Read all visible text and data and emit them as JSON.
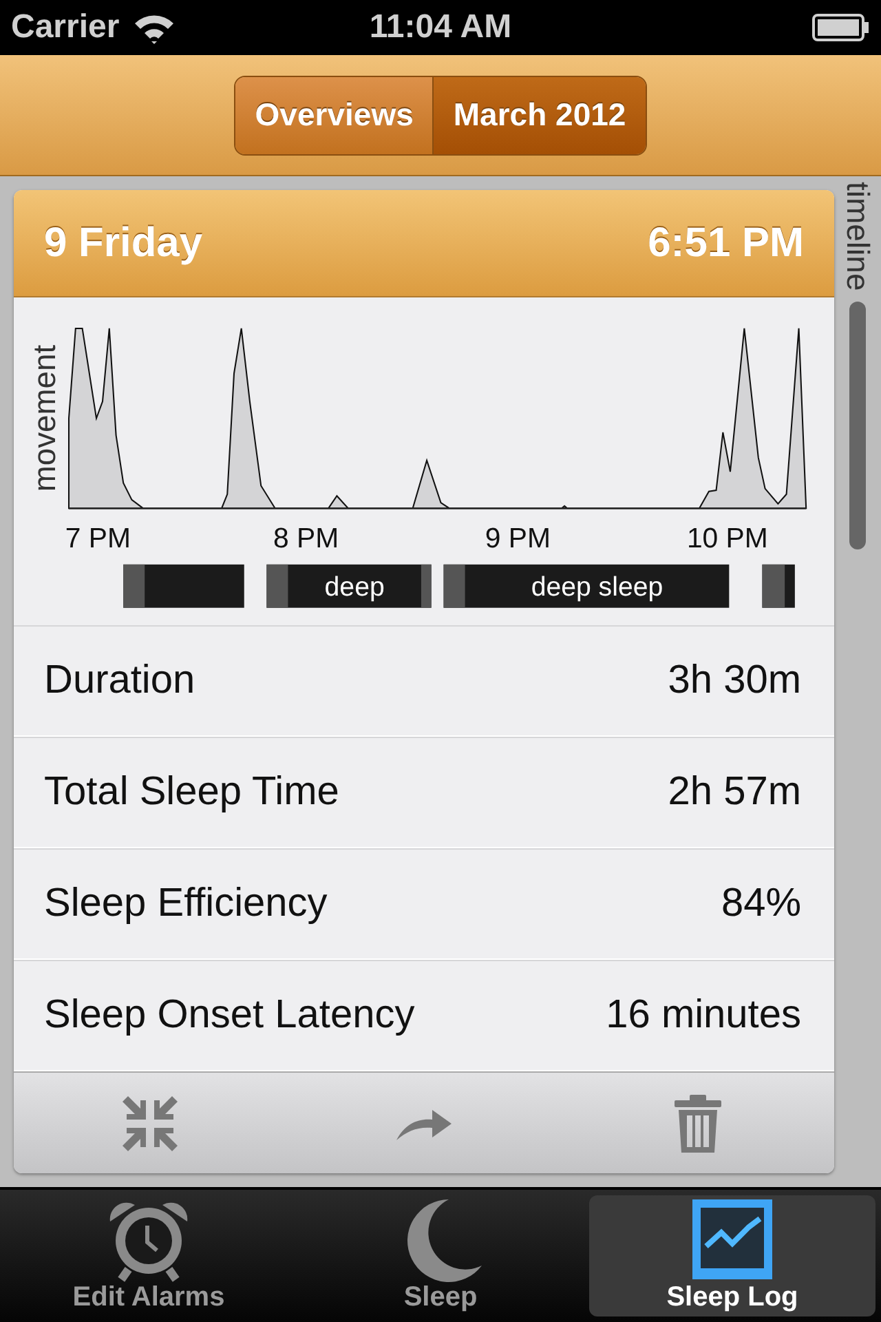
{
  "status_bar": {
    "carrier": "Carrier",
    "time": "11:04 AM"
  },
  "segments": [
    {
      "label": "Overviews",
      "selected": false
    },
    {
      "label": "March 2012",
      "selected": true
    }
  ],
  "card": {
    "day": "9 Friday",
    "time": "6:51 PM",
    "graph": {
      "ylabel": "movement",
      "xlabels": [
        "7 PM",
        "8 PM",
        "9 PM",
        "10 PM"
      ],
      "phases": [
        {
          "kind": "unlabeled"
        },
        {
          "kind": "labeled",
          "label": "deep"
        },
        {
          "kind": "labeled",
          "label": "deep sleep"
        },
        {
          "kind": "unlabeled"
        }
      ]
    },
    "stats": [
      {
        "label": "Duration",
        "value": "3h 30m"
      },
      {
        "label": "Total Sleep Time",
        "value": "2h 57m"
      },
      {
        "label": "Sleep Efficiency",
        "value": "84%"
      },
      {
        "label": "Sleep Onset Latency",
        "value": "16 minutes"
      }
    ]
  },
  "side_label": "timeline",
  "tabs": [
    {
      "label": "Edit Alarms",
      "kind": "alarm",
      "selected": false
    },
    {
      "label": "Sleep",
      "kind": "moon",
      "selected": false
    },
    {
      "label": "Sleep Log",
      "kind": "log",
      "selected": true
    }
  ]
}
